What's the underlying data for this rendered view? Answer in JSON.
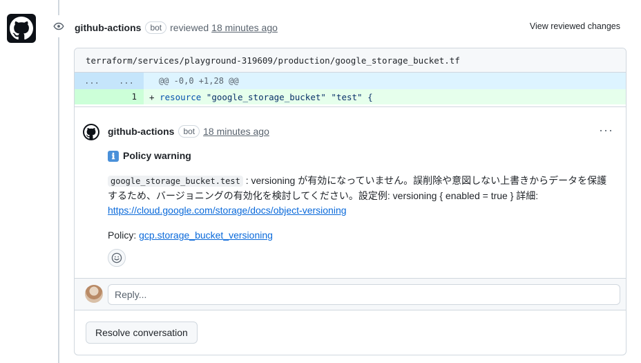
{
  "review": {
    "author": "github-actions",
    "bot_label": "bot",
    "action": "reviewed",
    "time": "18 minutes ago",
    "view_changes_label": "View reviewed changes"
  },
  "file": {
    "path": "terraform/services/playground-319609/production/google_storage_bucket.tf",
    "hunk_left": "...",
    "hunk_right": "...",
    "hunk_header": "@@ -0,0 +1,28 @@",
    "line_number": "1",
    "line_prefix": "+ ",
    "line_keyword": "resource",
    "line_rest": " \"google_storage_bucket\" \"test\" {"
  },
  "comment": {
    "author": "github-actions",
    "bot_label": "bot",
    "time": "18 minutes ago",
    "more_label": "···",
    "warning_icon": "ℹ",
    "warning_title": "Policy warning",
    "resource_code": "google_storage_bucket.test",
    "message": " : versioning が有効になっていません。誤削除や意図しない上書きからデータを保護するため、バージョニングの有効化を検討してください。設定例: versioning { enabled = true } 詳細: ",
    "doc_link": "https://cloud.google.com/storage/docs/object-versioning",
    "policy_label": "Policy: ",
    "policy_link": "gcp.storage_bucket_versioning"
  },
  "reply": {
    "placeholder": "Reply..."
  },
  "resolve_label": "Resolve conversation"
}
